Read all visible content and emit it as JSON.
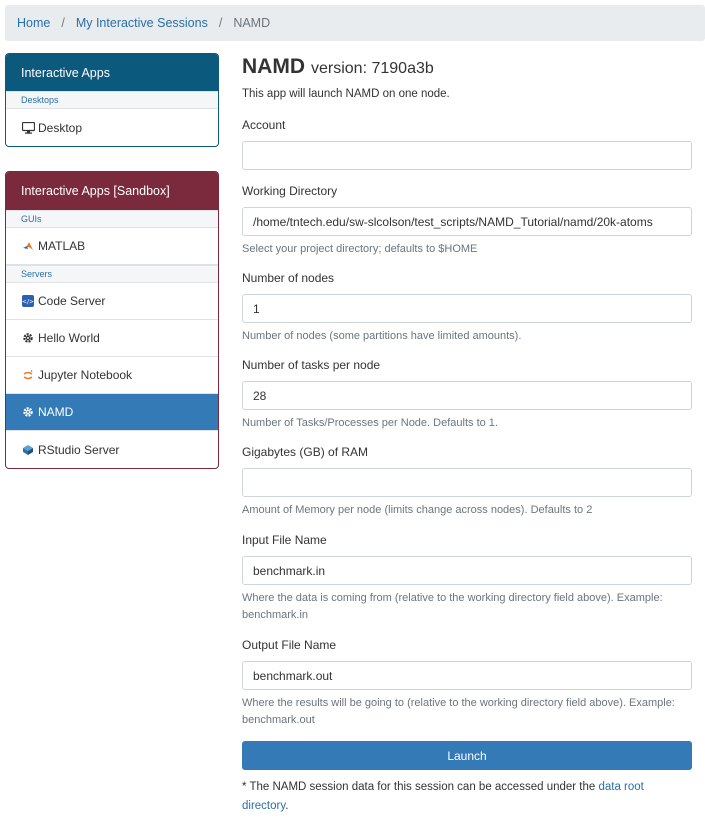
{
  "breadcrumb": {
    "home": "Home",
    "sessions": "My Interactive Sessions",
    "current": "NAMD",
    "separator": "/"
  },
  "sidebar": {
    "primary": {
      "title": "Interactive Apps",
      "group": "Desktops",
      "items": [
        {
          "label": "Desktop",
          "icon": "monitor-icon"
        }
      ]
    },
    "sandbox": {
      "title": "Interactive Apps [Sandbox]",
      "groups": [
        {
          "label": "GUIs",
          "items": [
            {
              "label": "MATLAB",
              "icon": "matlab-icon"
            }
          ]
        },
        {
          "label": "Servers",
          "items": [
            {
              "label": "Code Server",
              "icon": "code-server-icon"
            },
            {
              "label": "Hello World",
              "icon": "gear-icon"
            },
            {
              "label": "Jupyter Notebook",
              "icon": "jupyter-icon"
            },
            {
              "label": "NAMD",
              "icon": "gear-icon",
              "active": true
            },
            {
              "label": "RStudio Server",
              "icon": "rstudio-icon"
            }
          ]
        }
      ]
    }
  },
  "main": {
    "title": "NAMD",
    "version": "version: 7190a3b",
    "subtitle": "This app will launch NAMD on one node.",
    "fields": {
      "account": {
        "label": "Account",
        "value": ""
      },
      "working_directory": {
        "label": "Working Directory",
        "value": "/home/tntech.edu/sw-slcolson/test_scripts/NAMD_Tutorial/namd/20k-atoms",
        "help": "Select your project directory; defaults to $HOME"
      },
      "nodes": {
        "label": "Number of nodes",
        "value": "1",
        "help": "Number of nodes (some partitions have limited amounts)."
      },
      "tasks": {
        "label": "Number of tasks per node",
        "value": "28",
        "help": "Number of Tasks/Processes per Node. Defaults to 1."
      },
      "ram": {
        "label": "Gigabytes (GB) of RAM",
        "value": "",
        "help": "Amount of Memory per node (limits change across nodes). Defaults to 2"
      },
      "input_file": {
        "label": "Input File Name",
        "value": "benchmark.in",
        "help": "Where the data is coming from (relative to the working directory field above). Example: benchmark.in"
      },
      "output_file": {
        "label": "Output File Name",
        "value": "benchmark.out",
        "help": "Where the results will be going to (relative to the working directory field above). Example: benchmark.out"
      }
    },
    "launch_label": "Launch",
    "note_prefix": "* The NAMD session data for this session can be accessed under the ",
    "note_link": "data root directory",
    "note_suffix": "."
  },
  "colors": {
    "primary": "#337ab7",
    "sidebar_blue": "#0b5a7d",
    "sidebar_red": "#7a2a3c"
  }
}
